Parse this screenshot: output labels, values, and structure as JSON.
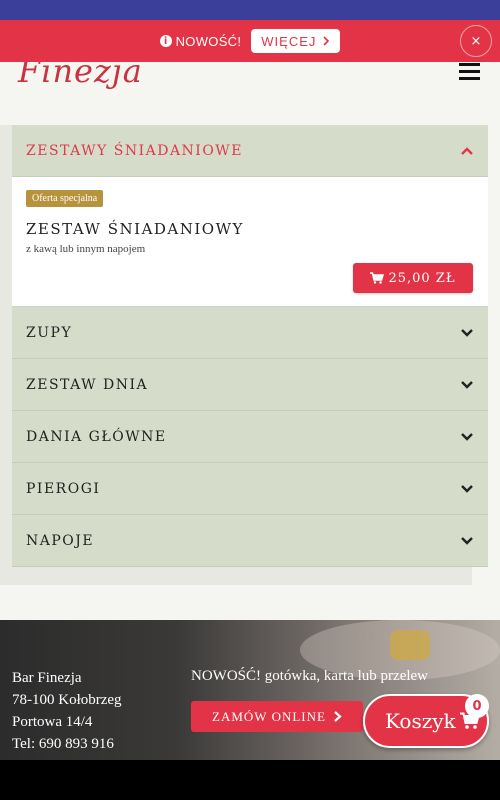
{
  "notice": {
    "text": "NOWOŚĆ!",
    "more_label": "WIĘCEJ",
    "close_label": "×"
  },
  "brand": {
    "logo": "Finezja",
    "accent": "#e23446",
    "logo_color": "#c9323f"
  },
  "menu": {
    "open_category": "ZESTAWY ŚNIADANIOWE",
    "item": {
      "badge": "Oferta specjalna",
      "name": "ZESTAW ŚNIADANIOWY",
      "description": "z kawą lub innym napojem",
      "price": "25,00 ZŁ"
    },
    "categories": [
      "ZUPY",
      "ZESTAW DNIA",
      "DANIA GŁÓWNE",
      "PIEROGI",
      "NAPOJE"
    ]
  },
  "footer": {
    "address": [
      "Bar Finezja",
      "78-100 Kołobrzeg",
      "Portowa 14/4",
      "Tel: 690 893 916"
    ],
    "note": "NOWOŚĆ! gotówka, karta lub przelew",
    "order_label": "ZAMÓW ONLINE"
  },
  "cart": {
    "label": "Koszyk",
    "count": "0"
  }
}
